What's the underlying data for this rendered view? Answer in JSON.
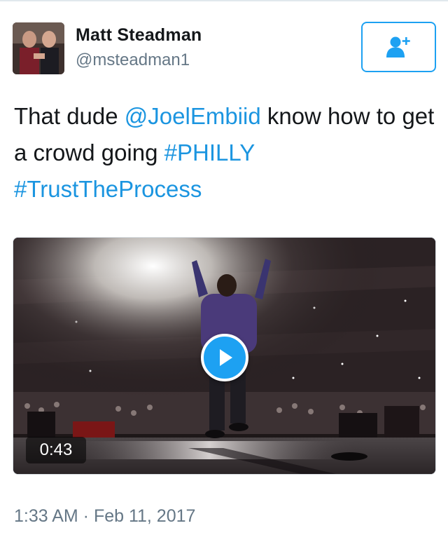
{
  "user": {
    "name": "Matt Steadman",
    "handle": "@msteadman1"
  },
  "follow_button": {
    "icon": "add-user-icon",
    "color": "#1da1f2"
  },
  "tweet": {
    "segments": [
      {
        "text": "That dude ",
        "type": "text"
      },
      {
        "text": "@JoelEmbiid",
        "type": "mention"
      },
      {
        "text": " know how to get a crowd going ",
        "type": "text"
      },
      {
        "text": "#PHILLY",
        "type": "hashtag"
      },
      {
        "text": " ",
        "type": "text"
      },
      {
        "text": "#TrustTheProcess",
        "type": "hashtag"
      }
    ],
    "link_color": "#1b95e0"
  },
  "media": {
    "type": "video",
    "duration": "0:43",
    "play_icon": "play-icon"
  },
  "timestamp": "1:33 AM · Feb 11, 2017"
}
